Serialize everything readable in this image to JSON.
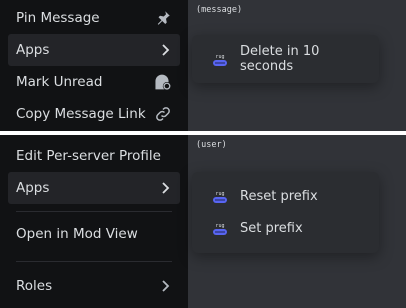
{
  "top_menu": {
    "items": [
      {
        "label": "Pin Message",
        "icon": "pin-icon"
      },
      {
        "label": "Apps",
        "icon": "chevron-right-icon"
      },
      {
        "label": "Mark Unread",
        "icon": "mark-unread-icon"
      },
      {
        "label": "Copy Message Link",
        "icon": "link-icon"
      }
    ],
    "context_tag": "(message)",
    "submenu": [
      {
        "label": "Delete in 10 seconds",
        "icon": "bot-avatar-icon"
      }
    ]
  },
  "bottom_menu": {
    "items": [
      {
        "label": "Edit Per-server Profile"
      },
      {
        "label": "Apps",
        "icon": "chevron-right-icon"
      },
      {
        "label": "Open in Mod View"
      },
      {
        "label": "Roles",
        "icon": "chevron-right-icon"
      }
    ],
    "context_tag": "(user)",
    "submenu": [
      {
        "label": "Reset prefix",
        "icon": "bot-avatar-icon"
      },
      {
        "label": "Set prefix",
        "icon": "bot-avatar-icon"
      }
    ]
  },
  "colors": {
    "menu_bg": "#111214",
    "active_bg": "#232428",
    "submenu_bg": "#2b2d31",
    "text": "#dbdee1",
    "icon": "#b5bac1",
    "bot_accent": "#5865f2"
  }
}
